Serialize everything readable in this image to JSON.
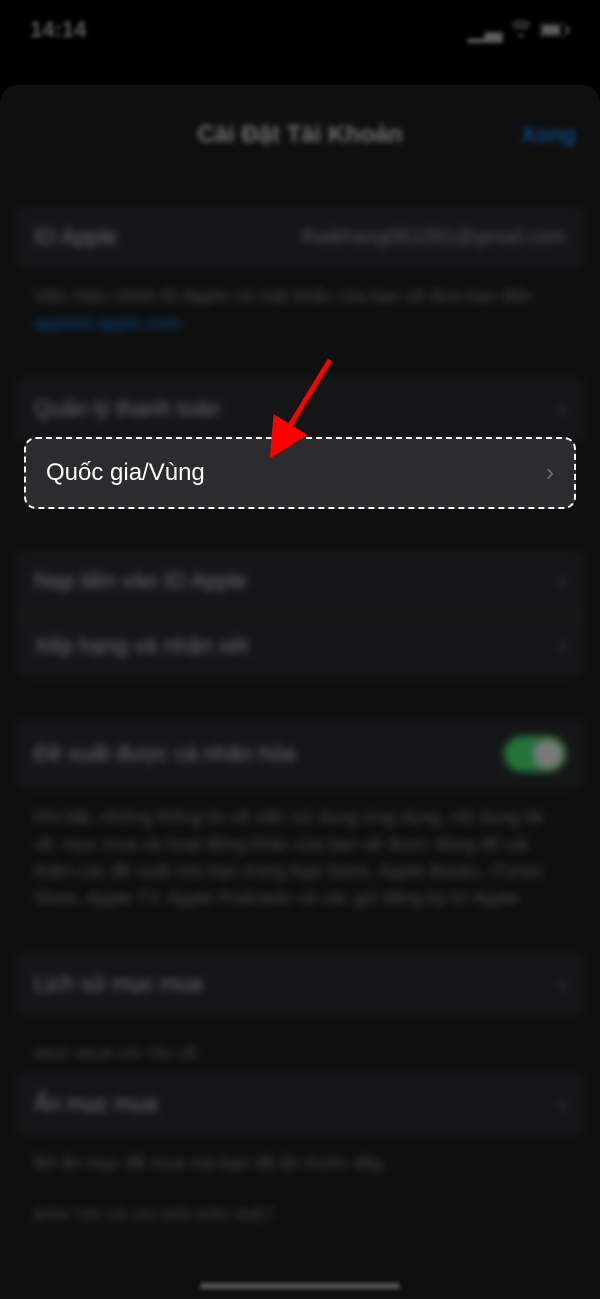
{
  "status": {
    "time": "14:14"
  },
  "header": {
    "title": "Cài Đặt Tài Khoản",
    "done": "Xong"
  },
  "appleId": {
    "label": "ID Apple",
    "value": "thaikhang061091@gmail.com",
    "footer_prefix": "Việc hiệu chỉnh ID Apple và mật khẩu của bạn sẽ đưa bạn đến ",
    "footer_link": "appleid.apple.com"
  },
  "group2": {
    "row1": "Quản lý thanh toán",
    "row2": "Quốc gia/Vùng"
  },
  "group3": {
    "row1": "Nạp tiền vào ID Apple",
    "row2": "Xếp hạng và nhận xét"
  },
  "group4": {
    "row1": "Đề xuất được cá nhân hóa",
    "footer": "Khi bật, những thông tin về việc sử dụng ứng dụng, nội dung tải về, mục mua và hoạt động khác của bạn sẽ được dùng để cải thiện các đề xuất cho bạn trong App Store, Apple Books, iTunes Store, Apple TV, Apple Podcasts và các gói đăng ký từ Apple."
  },
  "group5": {
    "row1": "Lịch sử mục mua"
  },
  "section_header": "MỤC MUA VÀ TẢI VỀ",
  "group6": {
    "row1": "Ẩn mục mua",
    "footer": "Bỏ ẩn mục đã mua mà bạn đã ẩn trước đây."
  },
  "section_header2": "BẢN TIN VÀ ƯU ĐÃI ĐẶC BIỆT"
}
